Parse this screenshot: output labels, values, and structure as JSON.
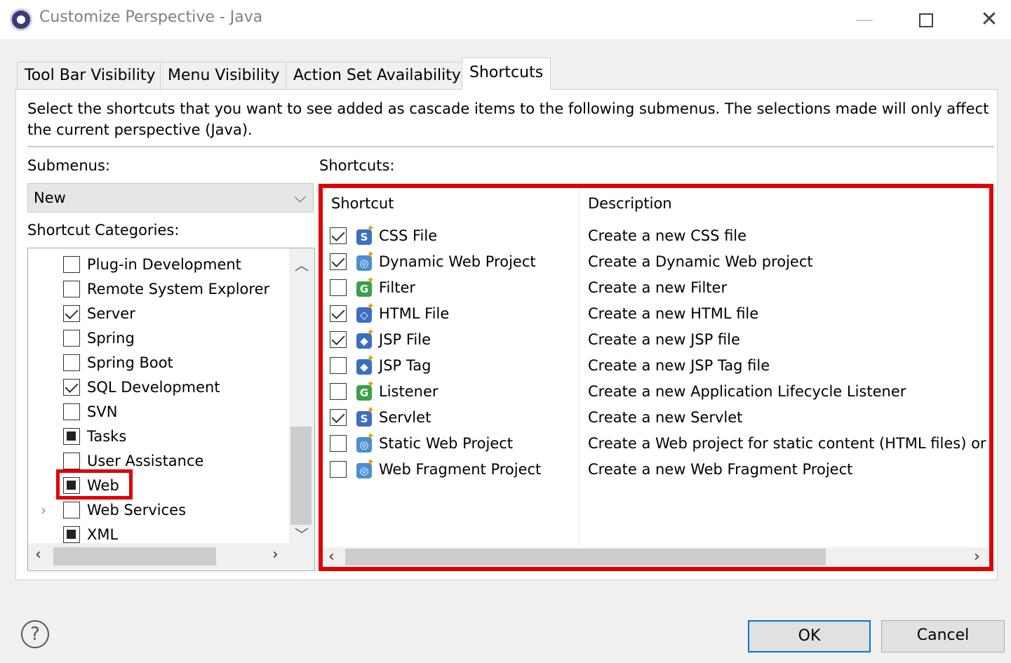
{
  "window": {
    "title": "Customize Perspective - Java",
    "minimize": "—",
    "close": "✕"
  },
  "tabs": [
    {
      "label": "Tool Bar Visibility"
    },
    {
      "label": "Menu Visibility"
    },
    {
      "label": "Action Set Availability"
    },
    {
      "label": "Shortcuts",
      "active": true
    }
  ],
  "intro": "Select the shortcuts that you want to see added as cascade items to the following submenus.  The selections made will only affect the current perspective (Java).",
  "submenus": {
    "label": "Submenus:",
    "selected": "New",
    "chevron": "⌵"
  },
  "categories": {
    "label": "Shortcut Categories:",
    "items": [
      {
        "label": "Plug-in Development",
        "state": "unchecked"
      },
      {
        "label": "Remote System Explorer",
        "state": "unchecked"
      },
      {
        "label": "Server",
        "state": "checked"
      },
      {
        "label": "Spring",
        "state": "unchecked"
      },
      {
        "label": "Spring Boot",
        "state": "unchecked"
      },
      {
        "label": "SQL Development",
        "state": "checked"
      },
      {
        "label": "SVN",
        "state": "unchecked"
      },
      {
        "label": "Tasks",
        "state": "partial"
      },
      {
        "label": "User Assistance",
        "state": "unchecked"
      },
      {
        "label": "Web",
        "state": "partial",
        "highlighted": true
      },
      {
        "label": "Web Services",
        "state": "unchecked",
        "expandable": true
      },
      {
        "label": "XML",
        "state": "partial"
      }
    ]
  },
  "shortcuts": {
    "label": "Shortcuts:",
    "columns": [
      "Shortcut",
      "Description"
    ],
    "rows": [
      {
        "name": "CSS File",
        "description": "Create a new CSS file",
        "checked": true,
        "icon": "css-file-icon",
        "color": "#3b6fc4",
        "glyph": "S"
      },
      {
        "name": "Dynamic Web Project",
        "description": "Create a Dynamic Web project",
        "checked": true,
        "icon": "dynamic-web-project-icon",
        "color": "#4a8fd0",
        "glyph": "◎"
      },
      {
        "name": "Filter",
        "description": "Create a new Filter",
        "checked": false,
        "icon": "filter-icon",
        "color": "#3aa04a",
        "glyph": "G"
      },
      {
        "name": "HTML File",
        "description": "Create a new HTML file",
        "checked": true,
        "icon": "html-file-icon",
        "color": "#3b6fc4",
        "glyph": "◇"
      },
      {
        "name": "JSP File",
        "description": "Create a new JSP file",
        "checked": true,
        "icon": "jsp-file-icon",
        "color": "#3b6fc4",
        "glyph": "◆"
      },
      {
        "name": "JSP Tag",
        "description": "Create a new JSP Tag file",
        "checked": false,
        "icon": "jsp-tag-icon",
        "color": "#3b6fc4",
        "glyph": "◆"
      },
      {
        "name": "Listener",
        "description": "Create a new Application Lifecycle Listener",
        "checked": false,
        "icon": "listener-icon",
        "color": "#3aa04a",
        "glyph": "G"
      },
      {
        "name": "Servlet",
        "description": "Create a new Servlet",
        "checked": true,
        "icon": "servlet-icon",
        "color": "#3b6fc4",
        "glyph": "S"
      },
      {
        "name": "Static Web Project",
        "description": "Create a Web project for static content (HTML files) or",
        "checked": false,
        "icon": "static-web-project-icon",
        "color": "#4a8fd0",
        "glyph": "◎"
      },
      {
        "name": "Web Fragment Project",
        "description": "Create a new Web Fragment Project",
        "checked": false,
        "icon": "web-fragment-project-icon",
        "color": "#4a8fd0",
        "glyph": "◎"
      }
    ]
  },
  "buttons": {
    "help": "?",
    "ok": "OK",
    "cancel": "Cancel"
  },
  "colors": {
    "highlight": "#e00000",
    "focus": "#0078d7"
  }
}
